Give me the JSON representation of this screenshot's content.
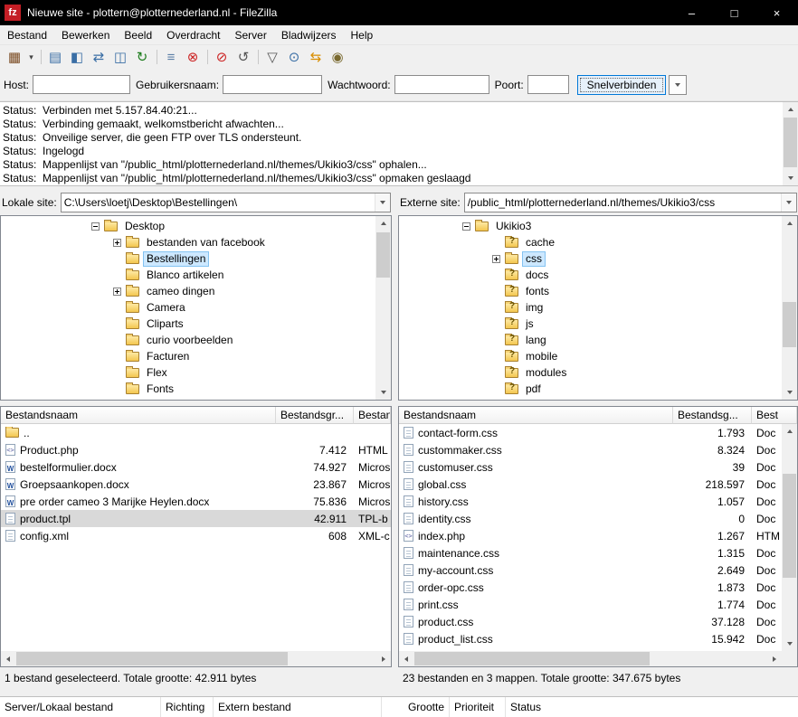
{
  "window": {
    "title": "Nieuwe site - plottern@plotternederland.nl - FileZilla",
    "app_icon_text": "fz",
    "controls": {
      "minimize": "–",
      "maximize": "□",
      "close": "×"
    }
  },
  "menu": {
    "items": [
      {
        "label": "Bestand"
      },
      {
        "label": "Bewerken"
      },
      {
        "label": "Beeld"
      },
      {
        "label": "Overdracht"
      },
      {
        "label": "Server"
      },
      {
        "label": "Bladwijzers"
      },
      {
        "label": "Help"
      }
    ]
  },
  "toolbar": {
    "items": [
      {
        "name": "site-manager-button",
        "glyph": "▦",
        "color": "#7a4a21",
        "interactable": "true"
      },
      {
        "name": "site-manager-dropdown",
        "glyph": "▾",
        "color": "#444444",
        "narrow": true,
        "interactable": "true"
      },
      {
        "name": "toolbar-separator",
        "sep": true,
        "interactable": "false"
      },
      {
        "name": "toggle-message-log-button",
        "glyph": "▤",
        "color": "#3a6ea5",
        "interactable": "true"
      },
      {
        "name": "toggle-local-tree-button",
        "glyph": "◧",
        "color": "#3a6ea5",
        "interactable": "true"
      },
      {
        "name": "toggle-remote-tree-button",
        "glyph": "⇄",
        "color": "#3a6ea5",
        "interactable": "true"
      },
      {
        "name": "toggle-queue-button",
        "glyph": "◫",
        "color": "#3a6ea5",
        "interactable": "true"
      },
      {
        "name": "refresh-button",
        "glyph": "↻",
        "color": "#1e7d1e",
        "interactable": "true"
      },
      {
        "name": "toolbar-separator",
        "sep": true,
        "interactable": "false"
      },
      {
        "name": "process-queue-button",
        "glyph": "≡",
        "color": "#5b7fa6",
        "interactable": "true"
      },
      {
        "name": "cancel-transfer-button",
        "glyph": "⊗",
        "color": "#cc2222",
        "interactable": "true"
      },
      {
        "name": "toolbar-separator",
        "sep": true,
        "interactable": "false"
      },
      {
        "name": "disconnect-button",
        "glyph": "⊘",
        "color": "#cc2222",
        "interactable": "true"
      },
      {
        "name": "reconnect-button",
        "glyph": "↺",
        "color": "#555555",
        "interactable": "true"
      },
      {
        "name": "toolbar-separator",
        "sep": true,
        "interactable": "false"
      },
      {
        "name": "filter-button",
        "glyph": "▽",
        "color": "#555555",
        "interactable": "true"
      },
      {
        "name": "compare-directories-button",
        "glyph": "⊙",
        "color": "#3a6ea5",
        "interactable": "true"
      },
      {
        "name": "synchronized-browsing-button",
        "glyph": "⇆",
        "color": "#d98e00",
        "interactable": "true"
      },
      {
        "name": "find-files-button",
        "glyph": "◉",
        "color": "#7a6a30",
        "interactable": "true"
      }
    ]
  },
  "quickconnect": {
    "host_label": "Host:",
    "host_value": "",
    "user_label": "Gebruikersnaam:",
    "user_value": "",
    "password_label": "Wachtwoord:",
    "password_value": "",
    "port_label": "Poort:",
    "port_value": "",
    "connect_button": "Snelverbinden"
  },
  "log": {
    "lines": [
      {
        "prefix": "Status:",
        "text": "Verbinden met 5.157.84.40:21..."
      },
      {
        "prefix": "Status:",
        "text": "Verbinding gemaakt, welkomstbericht afwachten..."
      },
      {
        "prefix": "Status:",
        "text": "Onveilige server, die geen FTP over TLS ondersteunt."
      },
      {
        "prefix": "Status:",
        "text": "Ingelogd"
      },
      {
        "prefix": "Status:",
        "text": "Mappenlijst van \"/public_html/plotternederland.nl/themes/Ukikio3/css\" ophalen..."
      },
      {
        "prefix": "Status:",
        "text": "Mappenlijst van \"/public_html/plotternederland.nl/themes/Ukikio3/css\" opmaken geslaagd"
      }
    ]
  },
  "local_panel": {
    "path_label": "Lokale site:",
    "path_value": "C:\\Users\\loetj\\Desktop\\Bestellingen\\",
    "tree": [
      {
        "label": "Desktop",
        "level": 0,
        "expander": "minus",
        "icon": "folder"
      },
      {
        "label": "bestanden van facebook",
        "level": 1,
        "expander": "plus",
        "icon": "folder"
      },
      {
        "label": "Bestellingen",
        "level": 1,
        "expander": "none",
        "icon": "folder",
        "selected": true
      },
      {
        "label": "Blanco artikelen",
        "level": 1,
        "expander": "none",
        "icon": "folder"
      },
      {
        "label": "cameo dingen",
        "level": 1,
        "expander": "plus",
        "icon": "folder"
      },
      {
        "label": "Camera",
        "level": 1,
        "expander": "none",
        "icon": "folder"
      },
      {
        "label": "Cliparts",
        "level": 1,
        "expander": "none",
        "icon": "folder"
      },
      {
        "label": "curio voorbeelden",
        "level": 1,
        "expander": "none",
        "icon": "folder"
      },
      {
        "label": "Facturen",
        "level": 1,
        "expander": "none",
        "icon": "folder"
      },
      {
        "label": "Flex",
        "level": 1,
        "expander": "none",
        "icon": "folder"
      },
      {
        "label": "Fonts",
        "level": 1,
        "expander": "none",
        "icon": "folder"
      }
    ],
    "columns": {
      "name": "Bestandsnaam",
      "size": "Bestandsgr...",
      "type": "Bestan"
    },
    "files": [
      {
        "icon": "folder",
        "name": "..",
        "size": "",
        "type": ""
      },
      {
        "icon": "php",
        "name": "Product.php",
        "size": "7.412",
        "type": "HTML"
      },
      {
        "icon": "word",
        "name": "bestelformulier.docx",
        "size": "74.927",
        "type": "Micros"
      },
      {
        "icon": "word",
        "name": "Groepsaankopen.docx",
        "size": "23.867",
        "type": "Micros"
      },
      {
        "icon": "word",
        "name": "pre order cameo 3 Marijke Heylen.docx",
        "size": "75.836",
        "type": "Micros"
      },
      {
        "icon": "doc",
        "name": "product.tpl",
        "size": "42.911",
        "type": "TPL-b",
        "selected": true
      },
      {
        "icon": "doc",
        "name": "config.xml",
        "size": "608",
        "type": "XML-c"
      }
    ],
    "status": "1 bestand geselecteerd. Totale grootte: 42.911 bytes"
  },
  "remote_panel": {
    "path_label": "Externe site:",
    "path_value": "/public_html/plotternederland.nl/themes/Ukikio3/css",
    "tree": [
      {
        "label": "Ukikio3",
        "level": 0,
        "expander": "minus",
        "icon": "folder"
      },
      {
        "label": "cache",
        "level": 1,
        "expander": "none",
        "icon": "folder-question"
      },
      {
        "label": "css",
        "level": 1,
        "expander": "plus",
        "icon": "folder",
        "selected": true
      },
      {
        "label": "docs",
        "level": 1,
        "expander": "none",
        "icon": "folder-question"
      },
      {
        "label": "fonts",
        "level": 1,
        "expander": "none",
        "icon": "folder-question"
      },
      {
        "label": "img",
        "level": 1,
        "expander": "none",
        "icon": "folder-question"
      },
      {
        "label": "js",
        "level": 1,
        "expander": "none",
        "icon": "folder-question"
      },
      {
        "label": "lang",
        "level": 1,
        "expander": "none",
        "icon": "folder-question"
      },
      {
        "label": "mobile",
        "level": 1,
        "expander": "none",
        "icon": "folder-question"
      },
      {
        "label": "modules",
        "level": 1,
        "expander": "none",
        "icon": "folder-question"
      },
      {
        "label": "pdf",
        "level": 1,
        "expander": "none",
        "icon": "folder-question"
      }
    ],
    "columns": {
      "name": "Bestandsnaam",
      "size": "Bestandsg...",
      "type": "Best"
    },
    "files": [
      {
        "icon": "doc",
        "name": "contact-form.css",
        "size": "1.793",
        "type": "Doc"
      },
      {
        "icon": "doc",
        "name": "custommaker.css",
        "size": "8.324",
        "type": "Doc"
      },
      {
        "icon": "doc",
        "name": "customuser.css",
        "size": "39",
        "type": "Doc"
      },
      {
        "icon": "doc",
        "name": "global.css",
        "size": "218.597",
        "type": "Doc"
      },
      {
        "icon": "doc",
        "name": "history.css",
        "size": "1.057",
        "type": "Doc"
      },
      {
        "icon": "doc",
        "name": "identity.css",
        "size": "0",
        "type": "Doc"
      },
      {
        "icon": "php",
        "name": "index.php",
        "size": "1.267",
        "type": "HTM"
      },
      {
        "icon": "doc",
        "name": "maintenance.css",
        "size": "1.315",
        "type": "Doc"
      },
      {
        "icon": "doc",
        "name": "my-account.css",
        "size": "2.649",
        "type": "Doc"
      },
      {
        "icon": "doc",
        "name": "order-opc.css",
        "size": "1.873",
        "type": "Doc"
      },
      {
        "icon": "doc",
        "name": "print.css",
        "size": "1.774",
        "type": "Doc"
      },
      {
        "icon": "doc",
        "name": "product.css",
        "size": "37.128",
        "type": "Doc"
      },
      {
        "icon": "doc",
        "name": "product_list.css",
        "size": "15.942",
        "type": "Doc"
      }
    ],
    "status": "23 bestanden en 3 mappen. Totale grootte: 347.675 bytes"
  },
  "queue": {
    "columns": [
      "Server/Lokaal bestand",
      "Richting",
      "Extern bestand",
      "Grootte",
      "Prioriteit",
      "Status"
    ]
  }
}
